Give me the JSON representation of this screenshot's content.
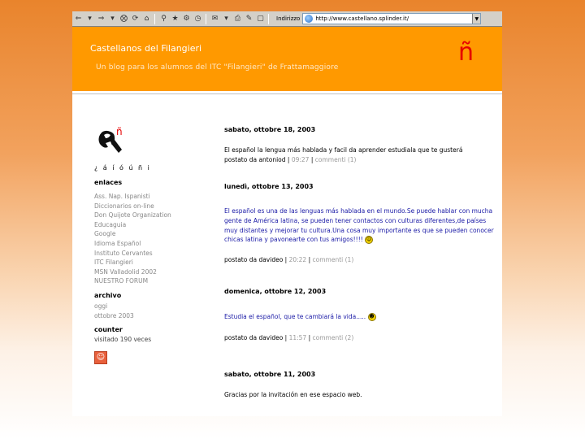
{
  "browser": {
    "address_label": "Indirizzo",
    "url": "http://www.castellano.splinder.it/",
    "toolbar_icons": [
      "back-icon",
      "forward-icon",
      "stop-icon",
      "refresh-icon",
      "home-icon",
      "search-icon",
      "favorites-icon",
      "history-icon",
      "mail-icon",
      "print-icon",
      "edit-icon",
      "discuss-icon"
    ]
  },
  "header": {
    "title": "Castellanos del Filangieri",
    "subtitle": "Un blog para los alumnos del ITC \"Filangieri\" de Frattamaggiore",
    "logo_char": "ñ",
    "colors": {
      "header_bg": "#ff9900",
      "enye": "#e60000"
    }
  },
  "sidebar": {
    "accents": "¿ á í ó ú ñ i",
    "enlaces_title": "enlaces",
    "links": [
      "Ass. Nap. Ispanisti",
      "Diccionarios on-line",
      "Don Quijote Organization",
      "Educaguia",
      "Google",
      "Idioma Español",
      "Instituto Cervantes",
      "ITC Filangieri",
      "MSN Valladolid 2002",
      "NUESTRO FORUM"
    ],
    "archivo_title": "archivo",
    "archivo_items": [
      "oggi",
      "ottobre 2003"
    ],
    "counter_title": "counter",
    "counter_text": "visitado 190 veces"
  },
  "posts": [
    {
      "date": "sabato, ottobre 18, 2003",
      "body": "El español la lengua más hablada y facil da aprender estudiala que te gusterá",
      "author_prefix": "postato da antoniod |",
      "time": "09:27",
      "comments": "commenti (1)"
    },
    {
      "date": "lunedì, ottobre 13, 2003",
      "body": "El español es una de las lenguas más hablada en el mundo.Se puede hablar con mucha gente de América latina, se pueden tener contactos con culturas diferentes,de países muy distantes y mejorar tu cultura.Una cosa muy importante es que se pueden conocer chicas latina y pavonearte con tus amigos!!!!",
      "author_prefix": "postato da davideo |",
      "time": "20:22",
      "comments": "commenti (1)"
    },
    {
      "date": "domenica, ottobre 12, 2003",
      "body": "Estudia el español, que te cambiará la vida.....",
      "author_prefix": "postato da davideo |",
      "time": "11:57",
      "comments": "commenti (2)"
    },
    {
      "date": "sabato, ottobre 11, 2003",
      "body": "Gracias por la invitación en ese espacio web."
    }
  ]
}
